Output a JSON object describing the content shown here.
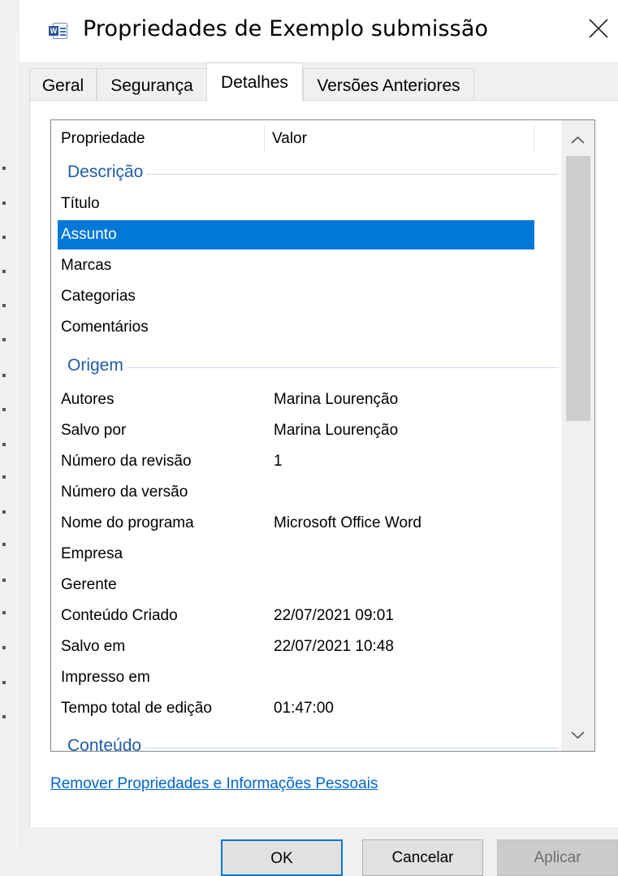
{
  "window": {
    "title": "Propriedades de Exemplo submissão",
    "app_icon": "word-document-icon",
    "close_icon": "close-icon"
  },
  "tabs": [
    {
      "label": "Geral",
      "active": false
    },
    {
      "label": "Segurança",
      "active": false
    },
    {
      "label": "Detalhes",
      "active": true
    },
    {
      "label": "Versões Anteriores",
      "active": false
    }
  ],
  "list": {
    "columns": [
      "Propriedade",
      "Valor"
    ],
    "groups": {
      "descricao": "Descrição",
      "origem": "Origem",
      "conteudo": "Conteúdo"
    },
    "descricao_rows": [
      {
        "key": "Título",
        "value": ""
      },
      {
        "key": "Assunto",
        "value": "",
        "selected": true
      },
      {
        "key": "Marcas",
        "value": ""
      },
      {
        "key": "Categorias",
        "value": ""
      },
      {
        "key": "Comentários",
        "value": ""
      }
    ],
    "origem_rows": [
      {
        "key": "Autores",
        "value": "Marina Lourenção"
      },
      {
        "key": "Salvo por",
        "value": "Marina Lourenção"
      },
      {
        "key": "Número da revisão",
        "value": "1"
      },
      {
        "key": "Número da versão",
        "value": ""
      },
      {
        "key": "Nome do programa",
        "value": "Microsoft Office Word"
      },
      {
        "key": "Empresa",
        "value": ""
      },
      {
        "key": "Gerente",
        "value": ""
      },
      {
        "key": "Conteúdo Criado",
        "value": "22/07/2021 09:01"
      },
      {
        "key": "Salvo em",
        "value": "22/07/2021 10:48"
      },
      {
        "key": "Impresso em",
        "value": ""
      },
      {
        "key": "Tempo total de edição",
        "value": "01:47:00"
      }
    ]
  },
  "link": "Remover Propriedades e Informações Pessoais",
  "buttons": {
    "ok": "OK",
    "cancel": "Cancelar",
    "apply": "Aplicar"
  },
  "colors": {
    "selection": "#0078d7",
    "group_header": "#1e5ea8",
    "link": "#0066cc"
  }
}
